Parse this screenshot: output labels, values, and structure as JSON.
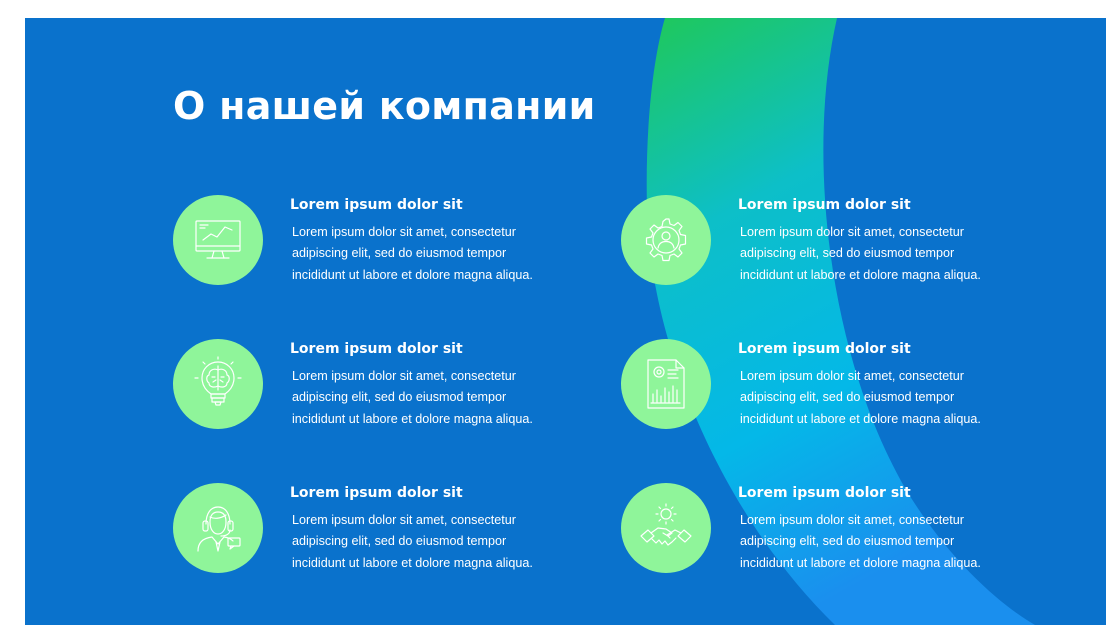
{
  "slide": {
    "title": "О нашей компании",
    "colors": {
      "background": "#0a72cc",
      "icon_circle": "#8ff59a",
      "arc_top": "#1fc85a",
      "arc_bottom": "#1aa3ff",
      "text": "#ffffff"
    }
  },
  "features": [
    {
      "icon": "monitor-chart-icon",
      "title": "Lorem ipsum dolor sit",
      "lines": [
        "Lorem ipsum dolor sit amet, consectetur",
        "adipiscing elit, sed do eiusmod tempor",
        "incididunt ut labore et dolore magna aliqua."
      ]
    },
    {
      "icon": "gear-person-icon",
      "title": "Lorem ipsum dolor sit",
      "lines": [
        "Lorem ipsum dolor sit amet, consectetur",
        "adipiscing elit, sed do eiusmod tempor",
        "incididunt ut labore et dolore magna aliqua."
      ]
    },
    {
      "icon": "lightbulb-brain-icon",
      "title": "Lorem ipsum dolor sit",
      "lines": [
        "Lorem ipsum dolor sit amet, consectetur",
        "adipiscing elit, sed do eiusmod tempor",
        "incididunt ut labore et dolore magna aliqua."
      ]
    },
    {
      "icon": "document-report-icon",
      "title": "Lorem ipsum dolor sit",
      "lines": [
        "Lorem ipsum dolor sit amet, consectetur",
        "adipiscing elit, sed do eiusmod tempor",
        "incididunt ut labore et dolore magna aliqua."
      ]
    },
    {
      "icon": "support-agent-icon",
      "title": "Lorem ipsum dolor sit",
      "lines": [
        "Lorem ipsum dolor sit amet, consectetur",
        "adipiscing elit, sed do eiusmod tempor",
        "incididunt ut labore et dolore magna aliqua."
      ]
    },
    {
      "icon": "handshake-gear-icon",
      "title": "Lorem ipsum dolor sit",
      "lines": [
        "Lorem ipsum dolor sit amet, consectetur",
        "adipiscing elit, sed do eiusmod tempor",
        "incididunt ut labore et dolore magna aliqua."
      ]
    }
  ]
}
